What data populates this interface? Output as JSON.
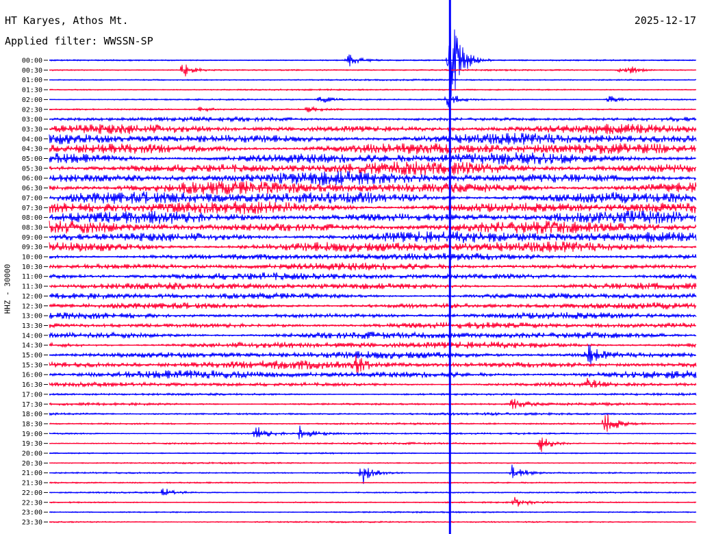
{
  "header": {
    "station": "HT Karyes, Athos Mt.",
    "date": "2025-12-17",
    "filter": "Applied filter: WWSSN-SP"
  },
  "channel_label": "HHZ - 30000",
  "colors": {
    "trace_a": "#0000ff",
    "trace_b": "#ff0033",
    "background": "#ffffff"
  },
  "chart_data": {
    "type": "line",
    "x_unit": "minutes",
    "x_range": [
      0,
      30
    ],
    "row_interval_minutes": 30,
    "rows": [
      {
        "time": "00:00",
        "color": "blue",
        "amplitude": 1
      },
      {
        "time": "00:30",
        "color": "red",
        "amplitude": 1
      },
      {
        "time": "01:00",
        "color": "blue",
        "amplitude": 1
      },
      {
        "time": "01:30",
        "color": "red",
        "amplitude": 1
      },
      {
        "time": "02:00",
        "color": "blue",
        "amplitude": 1
      },
      {
        "time": "02:30",
        "color": "red",
        "amplitude": 1
      },
      {
        "time": "03:00",
        "color": "blue",
        "amplitude": 4
      },
      {
        "time": "03:30",
        "color": "red",
        "amplitude": 9
      },
      {
        "time": "04:00",
        "color": "blue",
        "amplitude": 11
      },
      {
        "time": "04:30",
        "color": "red",
        "amplitude": 12
      },
      {
        "time": "05:00",
        "color": "blue",
        "amplitude": 12
      },
      {
        "time": "05:30",
        "color": "red",
        "amplitude": 13
      },
      {
        "time": "06:00",
        "color": "blue",
        "amplitude": 13
      },
      {
        "time": "06:30",
        "color": "red",
        "amplitude": 13
      },
      {
        "time": "07:00",
        "color": "blue",
        "amplitude": 13
      },
      {
        "time": "07:30",
        "color": "red",
        "amplitude": 13
      },
      {
        "time": "08:00",
        "color": "blue",
        "amplitude": 12
      },
      {
        "time": "08:30",
        "color": "red",
        "amplitude": 12
      },
      {
        "time": "09:00",
        "color": "blue",
        "amplitude": 12
      },
      {
        "time": "09:30",
        "color": "red",
        "amplitude": 11
      },
      {
        "time": "10:00",
        "color": "blue",
        "amplitude": 7
      },
      {
        "time": "10:30",
        "color": "red",
        "amplitude": 7
      },
      {
        "time": "11:00",
        "color": "blue",
        "amplitude": 7
      },
      {
        "time": "11:30",
        "color": "red",
        "amplitude": 7
      },
      {
        "time": "12:00",
        "color": "blue",
        "amplitude": 6
      },
      {
        "time": "12:30",
        "color": "red",
        "amplitude": 6
      },
      {
        "time": "13:00",
        "color": "blue",
        "amplitude": 6
      },
      {
        "time": "13:30",
        "color": "red",
        "amplitude": 6
      },
      {
        "time": "14:00",
        "color": "blue",
        "amplitude": 7
      },
      {
        "time": "14:30",
        "color": "red",
        "amplitude": 7
      },
      {
        "time": "15:00",
        "color": "blue",
        "amplitude": 7
      },
      {
        "time": "15:30",
        "color": "red",
        "amplitude": 8
      },
      {
        "time": "16:00",
        "color": "blue",
        "amplitude": 8
      },
      {
        "time": "16:30",
        "color": "red",
        "amplitude": 4
      },
      {
        "time": "17:00",
        "color": "blue",
        "amplitude": 2
      },
      {
        "time": "17:30",
        "color": "red",
        "amplitude": 2
      },
      {
        "time": "18:00",
        "color": "blue",
        "amplitude": 2
      },
      {
        "time": "18:30",
        "color": "red",
        "amplitude": 1.5
      },
      {
        "time": "19:00",
        "color": "blue",
        "amplitude": 1.5
      },
      {
        "time": "19:30",
        "color": "red",
        "amplitude": 1.5
      },
      {
        "time": "20:00",
        "color": "blue",
        "amplitude": 1
      },
      {
        "time": "20:30",
        "color": "red",
        "amplitude": 1
      },
      {
        "time": "21:00",
        "color": "blue",
        "amplitude": 1
      },
      {
        "time": "21:30",
        "color": "red",
        "amplitude": 1
      },
      {
        "time": "22:00",
        "color": "blue",
        "amplitude": 1
      },
      {
        "time": "22:30",
        "color": "red",
        "amplitude": 1
      },
      {
        "time": "23:00",
        "color": "blue",
        "amplitude": 1
      },
      {
        "time": "23:30",
        "color": "red",
        "amplitude": 1
      }
    ],
    "events": [
      {
        "row": "00:00",
        "minute": 13.9,
        "amplitude": 11
      },
      {
        "row": "00:30",
        "minute": 26.4,
        "amplitude": 7
      },
      {
        "row": "00:30",
        "minute": 27.0,
        "amplitude": 5
      },
      {
        "row": "00:30",
        "minute": 6.2,
        "amplitude": 14
      },
      {
        "row": "02:00",
        "minute": 12.6,
        "amplitude": 8
      },
      {
        "row": "02:00",
        "minute": 18.5,
        "amplitude": 16
      },
      {
        "row": "02:00",
        "minute": 26.0,
        "amplitude": 8
      },
      {
        "row": "02:30",
        "minute": 7.0,
        "amplitude": 5
      },
      {
        "row": "02:30",
        "minute": 12.0,
        "amplitude": 6
      },
      {
        "row": "00:00",
        "minute": 18.6,
        "amplitude": 90
      },
      {
        "row": "17:30",
        "minute": 21.5,
        "amplitude": 12
      },
      {
        "row": "18:30",
        "minute": 25.8,
        "amplitude": 22
      },
      {
        "row": "19:00",
        "minute": 9.6,
        "amplitude": 14
      },
      {
        "row": "19:00",
        "minute": 11.6,
        "amplitude": 16
      },
      {
        "row": "19:30",
        "minute": 22.8,
        "amplitude": 16
      },
      {
        "row": "21:00",
        "minute": 14.5,
        "amplitude": 22
      },
      {
        "row": "21:00",
        "minute": 21.5,
        "amplitude": 18
      },
      {
        "row": "22:00",
        "minute": 5.3,
        "amplitude": 8
      },
      {
        "row": "22:30",
        "minute": 21.6,
        "amplitude": 10
      },
      {
        "row": "15:30",
        "minute": 14.2,
        "amplitude": 14
      },
      {
        "row": "15:00",
        "minute": 25.0,
        "amplitude": 18
      },
      {
        "row": "16:30",
        "minute": 25.0,
        "amplitude": 10
      }
    ],
    "grid": false,
    "legend": "none"
  }
}
